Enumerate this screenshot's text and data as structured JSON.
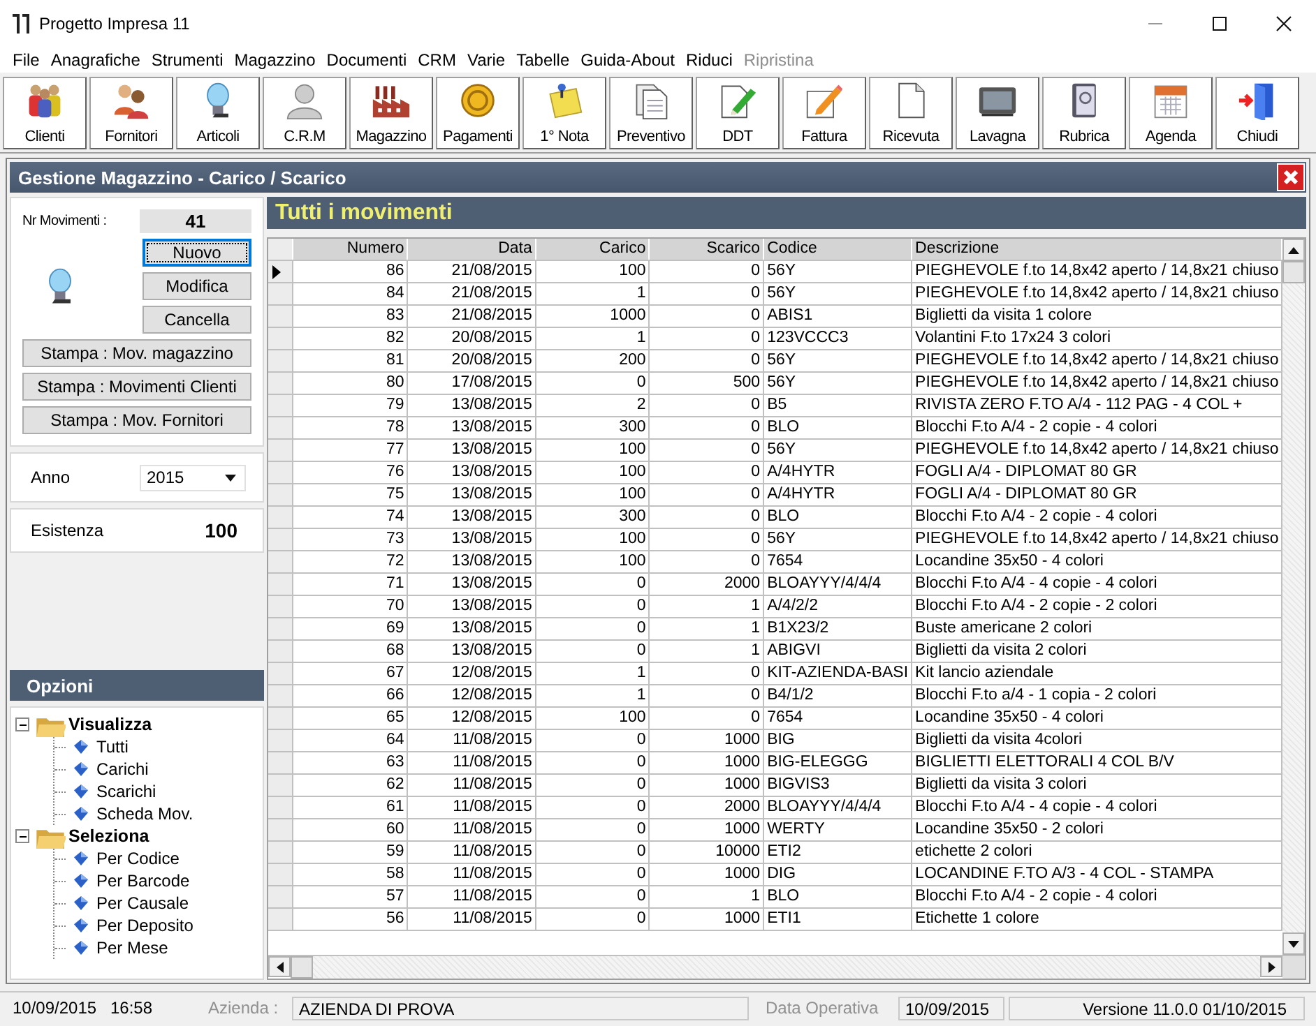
{
  "window": {
    "title": "Progetto Impresa 11"
  },
  "menu": [
    {
      "label": "File",
      "disabled": false
    },
    {
      "label": "Anagrafiche",
      "disabled": false
    },
    {
      "label": "Strumenti",
      "disabled": false
    },
    {
      "label": "Magazzino",
      "disabled": false
    },
    {
      "label": "Documenti",
      "disabled": false
    },
    {
      "label": "CRM",
      "disabled": false
    },
    {
      "label": "Varie",
      "disabled": false
    },
    {
      "label": "Tabelle",
      "disabled": false
    },
    {
      "label": "Guida-About",
      "disabled": false
    },
    {
      "label": "Riduci",
      "disabled": false
    },
    {
      "label": "Ripristina",
      "disabled": true
    }
  ],
  "toolbar": [
    "Clienti",
    "Fornitori",
    "Articoli",
    "C.R.M",
    "Magazzino",
    "Pagamenti",
    "1° Nota",
    "Preventivo",
    "DDT",
    "Fattura",
    "Ricevuta",
    "Lavagna",
    "Rubrica",
    "Agenda",
    "Chiudi"
  ],
  "panel": {
    "title": "Gestione Magazzino - Carico / Scarico"
  },
  "movements": {
    "label": "Nr Movimenti :",
    "value": "41"
  },
  "actions": [
    {
      "label": "Nuovo",
      "focused": true
    },
    {
      "label": "Modifica",
      "focused": false
    },
    {
      "label": "Cancella",
      "focused": false
    }
  ],
  "print_buttons": [
    "Stampa : Mov. magazzino",
    "Stampa : Movimenti Clienti",
    "Stampa : Mov. Fornitori"
  ],
  "anno": {
    "label": "Anno",
    "value": "2015"
  },
  "esistenza": {
    "label": "Esistenza",
    "value": "100"
  },
  "options": {
    "title": "Opzioni",
    "tree": [
      {
        "label": "Visualizza",
        "expanded": true,
        "children": [
          {
            "label": "Tutti"
          },
          {
            "label": "Carichi"
          },
          {
            "label": "Scarichi"
          },
          {
            "label": "Scheda Mov."
          }
        ]
      },
      {
        "label": "Seleziona",
        "expanded": true,
        "children": [
          {
            "label": "Per Codice"
          },
          {
            "label": "Per Barcode"
          },
          {
            "label": "Per Causale"
          },
          {
            "label": "Per Deposito"
          },
          {
            "label": "Per Mese"
          }
        ]
      }
    ]
  },
  "table": {
    "title": "Tutti i movimenti",
    "columns": [
      {
        "label": "Numero",
        "numeric": true
      },
      {
        "label": "Data",
        "numeric": true
      },
      {
        "label": "Carico",
        "numeric": true
      },
      {
        "label": "Scarico",
        "numeric": true
      },
      {
        "label": "Codice",
        "numeric": false
      },
      {
        "label": "Descrizione",
        "numeric": false
      }
    ],
    "rows": [
      {
        "selected": true,
        "cells": [
          "86",
          "21/08/2015",
          "100",
          "0",
          "56Y",
          "PIEGHEVOLE f.to 14,8x42 aperto / 14,8x21 chiuso"
        ]
      },
      {
        "selected": false,
        "cells": [
          "84",
          "21/08/2015",
          "1",
          "0",
          "56Y",
          "PIEGHEVOLE f.to 14,8x42 aperto / 14,8x21 chiuso"
        ]
      },
      {
        "selected": false,
        "cells": [
          "83",
          "21/08/2015",
          "1000",
          "0",
          "ABIS1",
          "Biglietti da visita 1 colore"
        ]
      },
      {
        "selected": false,
        "cells": [
          "82",
          "20/08/2015",
          "1",
          "0",
          "123VCCC3",
          "Volantini F.to 17x24 3 colori"
        ]
      },
      {
        "selected": false,
        "cells": [
          "81",
          "20/08/2015",
          "200",
          "0",
          "56Y",
          "PIEGHEVOLE f.to 14,8x42 aperto / 14,8x21 chiuso"
        ]
      },
      {
        "selected": false,
        "cells": [
          "80",
          "17/08/2015",
          "0",
          "500",
          "56Y",
          "PIEGHEVOLE f.to 14,8x42 aperto / 14,8x21 chiuso"
        ]
      },
      {
        "selected": false,
        "cells": [
          "79",
          "13/08/2015",
          "2",
          "0",
          "B5",
          "RIVISTA ZERO F.TO A/4 - 112 PAG - 4 COL +"
        ]
      },
      {
        "selected": false,
        "cells": [
          "78",
          "13/08/2015",
          "300",
          "0",
          "BLO",
          "Blocchi F.to A/4 - 2 copie - 4 colori"
        ]
      },
      {
        "selected": false,
        "cells": [
          "77",
          "13/08/2015",
          "100",
          "0",
          "56Y",
          "PIEGHEVOLE f.to 14,8x42 aperto / 14,8x21 chiuso"
        ]
      },
      {
        "selected": false,
        "cells": [
          "76",
          "13/08/2015",
          "100",
          "0",
          "A/4HYTR",
          "FOGLI A/4 - DIPLOMAT 80 GR"
        ]
      },
      {
        "selected": false,
        "cells": [
          "75",
          "13/08/2015",
          "100",
          "0",
          "A/4HYTR",
          "FOGLI A/4 - DIPLOMAT 80 GR"
        ]
      },
      {
        "selected": false,
        "cells": [
          "74",
          "13/08/2015",
          "300",
          "0",
          "BLO",
          "Blocchi F.to A/4 - 2 copie - 4 colori"
        ]
      },
      {
        "selected": false,
        "cells": [
          "73",
          "13/08/2015",
          "100",
          "0",
          "56Y",
          "PIEGHEVOLE f.to 14,8x42 aperto / 14,8x21 chiuso"
        ]
      },
      {
        "selected": false,
        "cells": [
          "72",
          "13/08/2015",
          "100",
          "0",
          "7654",
          "Locandine 35x50 - 4 colori"
        ]
      },
      {
        "selected": false,
        "cells": [
          "71",
          "13/08/2015",
          "0",
          "2000",
          "BLOAYYY/4/4/4",
          "Blocchi F.to A/4 - 4 copie - 4 colori"
        ]
      },
      {
        "selected": false,
        "cells": [
          "70",
          "13/08/2015",
          "0",
          "1",
          "A/4/2/2",
          "Blocchi F.to A/4 - 2 copie - 2 colori"
        ]
      },
      {
        "selected": false,
        "cells": [
          "69",
          "13/08/2015",
          "0",
          "1",
          "B1X23/2",
          "Buste americane 2 colori"
        ]
      },
      {
        "selected": false,
        "cells": [
          "68",
          "13/08/2015",
          "0",
          "1",
          "ABIGVI",
          "Biglietti da visita 2 colori"
        ]
      },
      {
        "selected": false,
        "cells": [
          "67",
          "12/08/2015",
          "1",
          "0",
          "KIT-AZIENDA-BASI",
          "Kit lancio aziendale"
        ]
      },
      {
        "selected": false,
        "cells": [
          "66",
          "12/08/2015",
          "1",
          "0",
          "B4/1/2",
          "Blocchi F.to a/4 - 1 copia - 2 colori"
        ]
      },
      {
        "selected": false,
        "cells": [
          "65",
          "12/08/2015",
          "100",
          "0",
          "7654",
          "Locandine 35x50 - 4 colori"
        ]
      },
      {
        "selected": false,
        "cells": [
          "64",
          "11/08/2015",
          "0",
          "1000",
          "BIG",
          "Biglietti da visita 4colori"
        ]
      },
      {
        "selected": false,
        "cells": [
          "63",
          "11/08/2015",
          "0",
          "1000",
          "BIG-ELEGGG",
          "BIGLIETTI ELETTORALI 4 COL B/V"
        ]
      },
      {
        "selected": false,
        "cells": [
          "62",
          "11/08/2015",
          "0",
          "1000",
          "BIGVIS3",
          "Biglietti da visita 3 colori"
        ]
      },
      {
        "selected": false,
        "cells": [
          "61",
          "11/08/2015",
          "0",
          "2000",
          "BLOAYYY/4/4/4",
          "Blocchi F.to A/4 - 4 copie - 4 colori"
        ]
      },
      {
        "selected": false,
        "cells": [
          "60",
          "11/08/2015",
          "0",
          "1000",
          "WERTY",
          "Locandine 35x50 - 2 colori"
        ]
      },
      {
        "selected": false,
        "cells": [
          "59",
          "11/08/2015",
          "0",
          "10000",
          "ETI2",
          "etichette 2 colori"
        ]
      },
      {
        "selected": false,
        "cells": [
          "58",
          "11/08/2015",
          "0",
          "1000",
          "DIG",
          "LOCANDINE F.TO A/3 - 4 COL - STAMPA"
        ]
      },
      {
        "selected": false,
        "cells": [
          "57",
          "11/08/2015",
          "0",
          "1",
          "BLO",
          "Blocchi F.to A/4 - 2 copie - 4 colori"
        ]
      },
      {
        "selected": false,
        "cells": [
          "56",
          "11/08/2015",
          "0",
          "1000",
          "ETI1",
          "Etichette 1 colore"
        ]
      }
    ]
  },
  "status_bar": {
    "date": "10/09/2015",
    "time": "16:58",
    "company_label": "Azienda :",
    "company": "AZIENDA DI PROVA",
    "date_label": "Data Operativa",
    "operative_date": "10/09/2015",
    "version": "Versione 11.0.0 01/10/2015"
  }
}
